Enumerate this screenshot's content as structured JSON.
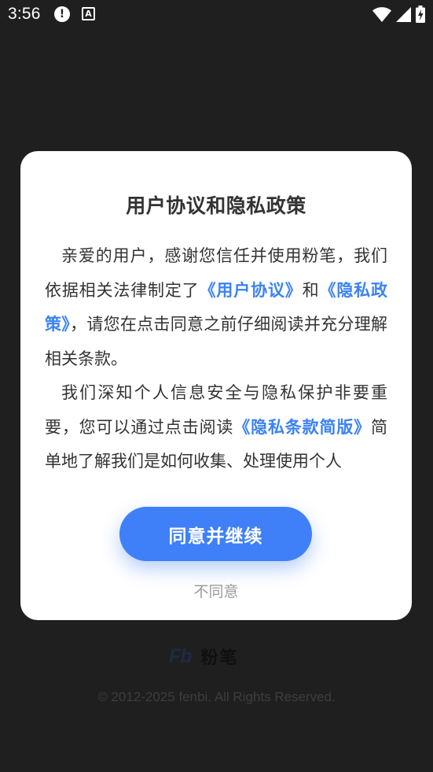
{
  "status_bar": {
    "time": "3:56",
    "alert_glyph": "!",
    "a_glyph": "A",
    "icons": [
      "alert-icon",
      "a-notification-icon",
      "wifi-icon",
      "signal-icon",
      "battery-icon"
    ]
  },
  "dialog": {
    "title": "用户协议和隐私政策",
    "paragraph1": {
      "text1": "亲爱的用户，感谢您信任并使用粉笔，我们依据相关法律制定了",
      "link1": "《用户协议》",
      "text2": "和",
      "link2": "《隐私政策》",
      "text3": "，请您在点击同意之前仔细阅读并充分理解相关条款。"
    },
    "paragraph2": {
      "text1": "我们深知个人信息安全与隐私保护非要重要，您可以通过点击阅读",
      "link1": "《隐私条款简版》",
      "text2": "简单地了解我们是如何收集、处理使用个人"
    },
    "agree_label": "同意并继续",
    "disagree_label": "不同意"
  },
  "footer": {
    "logo_text": "Fb",
    "brand_name": "粉笔",
    "copyright": "© 2012-2025 fenbi. All Rights Reserved."
  },
  "colors": {
    "background": "#1f1f1f",
    "dialog": "#ffffff",
    "accent": "#3f80f8",
    "link": "#3b82f6",
    "text": "#333333",
    "muted": "#9b9b9b"
  }
}
